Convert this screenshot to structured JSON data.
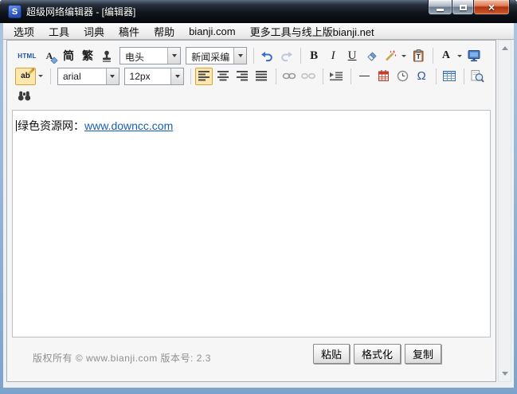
{
  "window": {
    "title": "超级网络编辑器 - [编辑器]"
  },
  "menu": {
    "items": [
      "选项",
      "工具",
      "词典",
      "稿件",
      "帮助",
      "bianji.com",
      "更多工具与线上版bianji.net"
    ]
  },
  "toolbar": {
    "row1": {
      "html": "HTML",
      "clear_format": "A",
      "simplified": "简",
      "traditional": "繁",
      "dateline_combo": "电头",
      "template_combo": "新闻采编",
      "bold": "B",
      "italic": "I",
      "underline": "U",
      "font_color": "A"
    },
    "row2": {
      "spellcheck": "ab",
      "font_family_combo": "arial",
      "font_size_combo": "12px",
      "special_char": "Ω"
    }
  },
  "icons": {
    "row1": [
      "html-source",
      "clear-format",
      "simplified-chinese",
      "traditional-chinese",
      "stamp",
      "undo",
      "redo",
      "bold",
      "italic",
      "underline",
      "eraser",
      "magic-wand",
      "paste-text-clipboard",
      "font-color",
      "monitor-preview"
    ],
    "row2": [
      "spellcheck-pencil",
      "align-left",
      "align-center",
      "align-right",
      "justify",
      "link",
      "unlink",
      "indent",
      "horizontal-rule",
      "calendar",
      "clock",
      "omega",
      "table",
      "zoom-preview"
    ],
    "row3": [
      "binoculars-find"
    ]
  },
  "editor": {
    "text": "绿色资源网：",
    "link": "www.downcc.com"
  },
  "footer": {
    "copyright": "版权所有 © www.bianji.com 版本号: 2.3",
    "paste_btn": "粘贴",
    "format_btn": "格式化",
    "copy_btn": "复制"
  },
  "colors": {
    "link": "#1660b2",
    "toolbar_highlight": "#fde7ad",
    "toolbar_highlight_border": "#d6a23e",
    "close_button": "#b03413",
    "titlebar": "#10151d"
  }
}
